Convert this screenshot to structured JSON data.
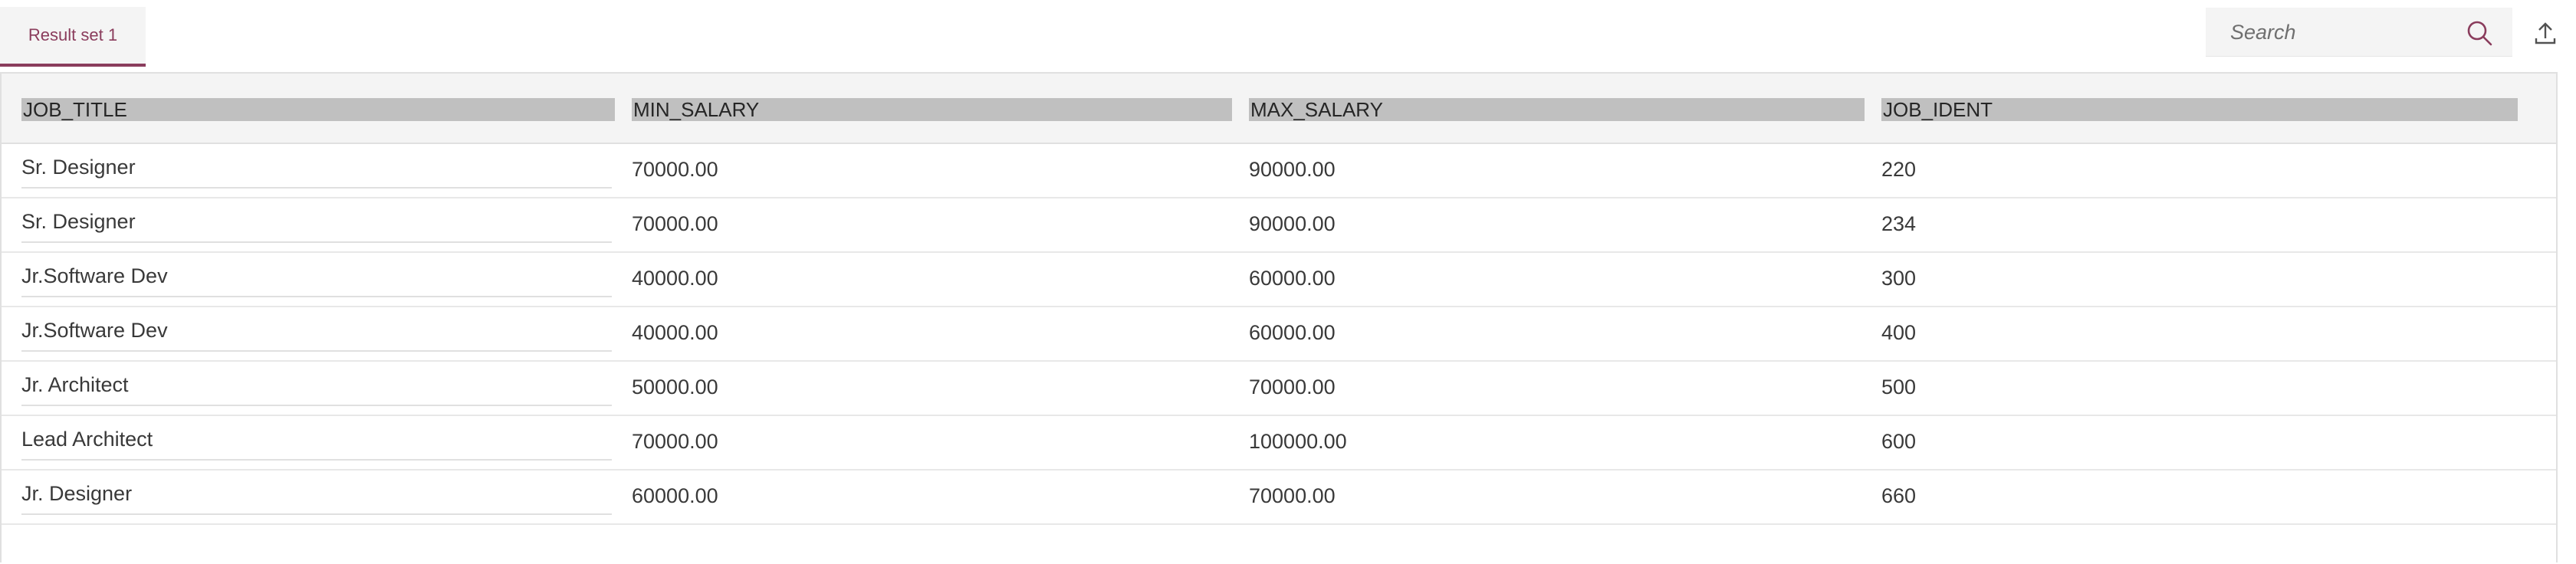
{
  "tabs": [
    {
      "label": "Result set 1",
      "selected": true
    }
  ],
  "search": {
    "placeholder": "Search",
    "value": ""
  },
  "icons": {
    "search": "search-icon",
    "export": "export-icon"
  },
  "colors": {
    "accent": "#8a3c5c",
    "header_cell_bg": "#c0c0c0",
    "header_bg": "#f4f4f4"
  },
  "table": {
    "columns": [
      "JOB_TITLE",
      "MIN_SALARY",
      "MAX_SALARY",
      "JOB_IDENT"
    ],
    "rows": [
      [
        "Sr. Designer",
        "70000.00",
        "90000.00",
        "220"
      ],
      [
        "Sr. Designer",
        "70000.00",
        "90000.00",
        "234"
      ],
      [
        "Jr.Software Dev",
        "40000.00",
        "60000.00",
        "300"
      ],
      [
        "Jr.Software Dev",
        "40000.00",
        "60000.00",
        "400"
      ],
      [
        "Jr. Architect",
        "50000.00",
        "70000.00",
        "500"
      ],
      [
        "Lead Architect",
        "70000.00",
        "100000.00",
        "600"
      ],
      [
        "Jr. Designer",
        "60000.00",
        "70000.00",
        "660"
      ]
    ]
  }
}
